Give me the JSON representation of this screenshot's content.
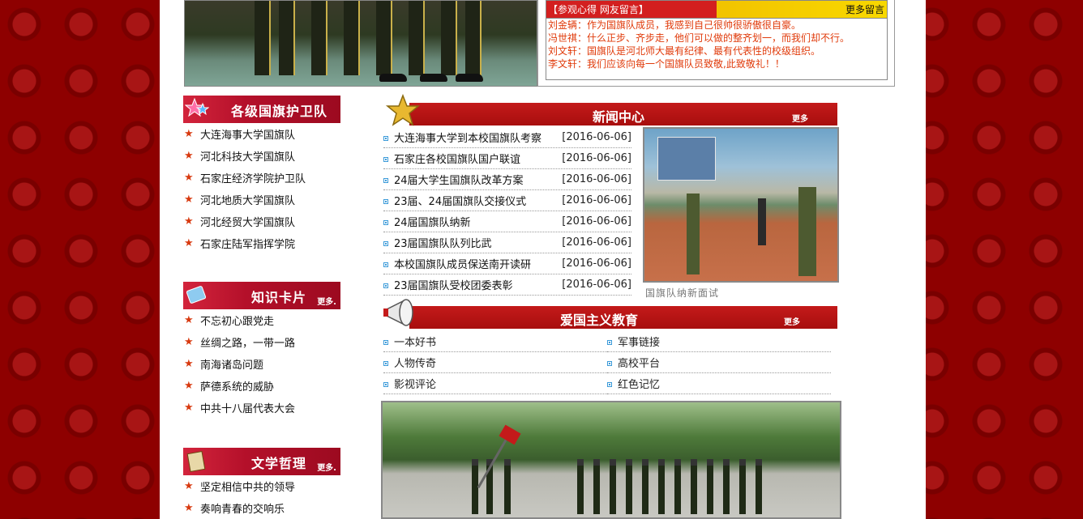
{
  "guestbook": {
    "title": "【参观心得  网友留言】",
    "more": "更多留言",
    "messages": [
      "刘金辆：作为国旗队成员，我感到自己很帅很骄傲很自豪。",
      "冯世祺：什么正步、齐步走，他们可以做的整齐划一，而我们却不行。",
      "刘文轩：国旗队是河北师大最有纪律、最有代表性的校级组织。",
      "李文轩：我们应该向每一个国旗队员致敬,此致敬礼！！"
    ]
  },
  "guards": {
    "title": "各级国旗护卫队",
    "items": [
      "大连海事大学国旗队",
      "河北科技大学国旗队",
      "石家庄经济学院护卫队",
      "河北地质大学国旗队",
      "河北经贸大学国旗队",
      "石家庄陆军指挥学院"
    ]
  },
  "knowledge": {
    "title": "知识卡片",
    "more": "更多.",
    "items": [
      "不忘初心跟党走",
      "丝绸之路，一带一路",
      "南海诸岛问题",
      "萨德系统的威胁",
      "中共十八届代表大会"
    ]
  },
  "philosophy": {
    "title": "文学哲理",
    "more": "更多.",
    "items": [
      "坚定相信中共的领导",
      "奏响青春的交响乐"
    ]
  },
  "news": {
    "title": "新闻中心",
    "more": "更多",
    "items": [
      {
        "title": "大连海事大学到本校国旗队考察",
        "date": "[2016-06-06]"
      },
      {
        "title": "石家庄各校国旗队国户联谊",
        "date": "[2016-06-06]"
      },
      {
        "title": "24届大学生国旗队改革方案",
        "date": "[2016-06-06]"
      },
      {
        "title": "23届、24届国旗队交接仪式",
        "date": "[2016-06-06]"
      },
      {
        "title": "24届国旗队纳新",
        "date": "[2016-06-06]"
      },
      {
        "title": "23届国旗队队列比武",
        "date": "[2016-06-06]"
      },
      {
        "title": "本校国旗队成员保送南开读研",
        "date": "[2016-06-06]"
      },
      {
        "title": "23届国旗队受校团委表彰",
        "date": "[2016-06-06]"
      }
    ],
    "photo_caption": "国旗队纳新面试"
  },
  "education": {
    "title": "爱国主义教育",
    "more": "更多",
    "items": [
      "一本好书",
      "军事链接",
      "人物传奇",
      "高校平台",
      "影视评论",
      "红色记忆"
    ]
  },
  "colors": {
    "page_bg": "#8e0000",
    "banner_red": "#b4102a",
    "message_text": "#e03a0a",
    "star": "#d83a10",
    "bullet": "#3a9ad9"
  }
}
